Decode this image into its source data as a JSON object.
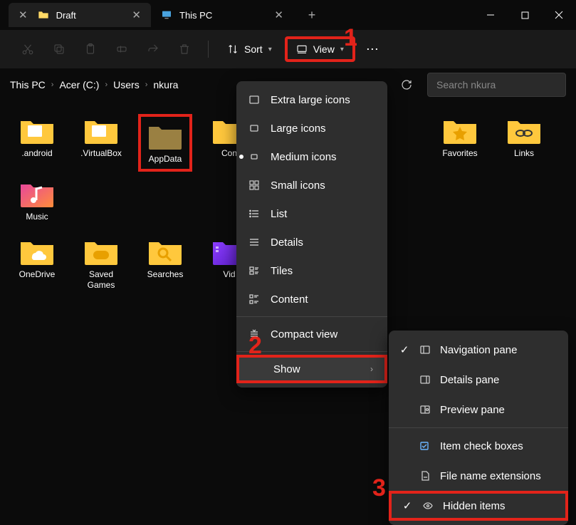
{
  "titlebar": {
    "tabs": [
      {
        "label": "Draft",
        "active": true,
        "icon": "folder"
      },
      {
        "label": "This PC",
        "active": false,
        "icon": "monitor"
      }
    ]
  },
  "toolbar": {
    "sort_label": "Sort",
    "view_label": "View"
  },
  "breadcrumbs": [
    "This PC",
    "Acer (C:)",
    "Users",
    "nkura"
  ],
  "search": {
    "placeholder": "Search nkura"
  },
  "folders": [
    {
      "label": ".android",
      "type": "folder-doc"
    },
    {
      "label": ".VirtualBox",
      "type": "folder-doc"
    },
    {
      "label": "AppData",
      "type": "folder-hidden",
      "highlighted": true
    },
    {
      "label": "Con",
      "type": "folder",
      "truncated": true
    },
    {
      "label": "Favorites",
      "type": "folder-star"
    },
    {
      "label": "Links",
      "type": "folder-link"
    },
    {
      "label": "Music",
      "type": "folder-music"
    },
    {
      "label": "OneDrive",
      "type": "folder-cloud"
    },
    {
      "label": "Saved Games",
      "type": "folder-game"
    },
    {
      "label": "Searches",
      "type": "folder-search"
    },
    {
      "label": "Vid",
      "type": "folder-video",
      "truncated": true
    }
  ],
  "view_menu": [
    {
      "label": "Extra large icons",
      "icon": "rect"
    },
    {
      "label": "Large icons",
      "icon": "rect"
    },
    {
      "label": "Medium icons",
      "icon": "rect",
      "selected": true
    },
    {
      "label": "Small icons",
      "icon": "grid4"
    },
    {
      "label": "List",
      "icon": "list"
    },
    {
      "label": "Details",
      "icon": "details"
    },
    {
      "label": "Tiles",
      "icon": "tiles"
    },
    {
      "label": "Content",
      "icon": "content"
    },
    {
      "divider": true
    },
    {
      "label": "Compact view",
      "icon": "compact"
    },
    {
      "divider": true
    },
    {
      "label": "Show",
      "icon": "",
      "submenu": true,
      "highlighted": true
    }
  ],
  "show_menu": [
    {
      "label": "Navigation pane",
      "icon": "nav-pane",
      "checked": true
    },
    {
      "label": "Details pane",
      "icon": "details-pane",
      "checked": false
    },
    {
      "label": "Preview pane",
      "icon": "preview-pane",
      "checked": false
    },
    {
      "divider": true
    },
    {
      "label": "Item check boxes",
      "icon": "checkbox",
      "checked": false
    },
    {
      "label": "File name extensions",
      "icon": "file-ext",
      "checked": false
    },
    {
      "label": "Hidden items",
      "icon": "eye",
      "checked": true,
      "highlighted": true
    }
  ],
  "annotations": {
    "one": "1",
    "two": "2",
    "three": "3"
  }
}
